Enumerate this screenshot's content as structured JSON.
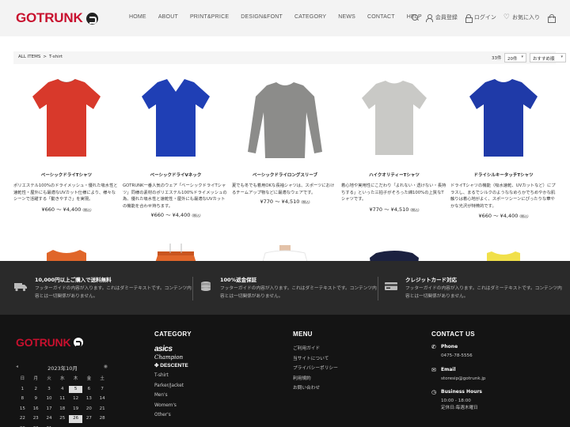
{
  "header": {
    "logo": "GOTRUNK",
    "nav": [
      "HOME",
      "ABOUT",
      "PRINT&PRICE",
      "DESIGN&FONT",
      "CATEGORY",
      "NEWS",
      "CONTACT",
      "HELP"
    ],
    "register": "会員登録",
    "login": "ログイン",
    "favorites": "お気に入り"
  },
  "breadcrumb": {
    "root": "ALL ITEMS",
    "sep": ">",
    "current": "T-shirt"
  },
  "toolbar": {
    "count": "33件",
    "per_page": "20件",
    "sort": "おすすめ順"
  },
  "products": [
    {
      "name": "ベーシックドライTシャツ",
      "desc": "ポリエステル100%のドライメッシュ・優れた吸水性と速乾性・屋外にも最適なUVカット仕様により、様々なシーンで活躍する「動きやすさ」を実現。",
      "price": "¥660 〜 ¥4,400",
      "tax": "(税込)",
      "color": "#d8392b"
    },
    {
      "name": "ベーシックドライVネック",
      "desc": "GOTRUNK一番人気のウェア「ベーシックドライTシャツ」同様の素材のポリエステル100%ドライメッシュの為、優れた吸水性と速乾性・屋外にも最適なUVカットの機能を合わせ持ちます。",
      "price": "¥660 〜 ¥4,400",
      "tax": "(税込)",
      "color": "#1f3fb5"
    },
    {
      "name": "ベーシックドライロングスリーブ",
      "desc": "夏でも冬でも着用OKな長袖シャツは、スポーツにおけるチームアップ物などに最適なウェアです。",
      "price": "¥770 〜 ¥4,510",
      "tax": "(税込)",
      "color": "#8c8c8a"
    },
    {
      "name": "ハイクオリティーTシャツ",
      "desc": "着心地や実用性にこだわり「よれない・透けない・長持ちする」といった三拍子がそろった綿100%の上質なTシャツです。",
      "price": "¥770 〜 ¥4,510",
      "tax": "(税込)",
      "color": "#c9c9c6"
    },
    {
      "name": "ドライシルキータッチTシャツ",
      "desc": "ドライTシャツの機能（吸水速乾、UVカットなど）にプラスし、まるでシルクのようななめらかでちめやかな肌触りは着心地がよく、スポーツシーンにぴったりな華やかな光沢が特徴的です。",
      "price": "¥660 〜 ¥4,400",
      "tax": "(税込)",
      "color": "#1f3aa8"
    }
  ],
  "row2_colors": [
    "#e0662a",
    "#e0662a",
    "#ffffff",
    "#1b2140",
    "#f1e04a"
  ],
  "features": [
    {
      "title": "10,000円以上ご購入で送料無料",
      "text": "フッターガイドの内容が入ります。これはダミーテキストです。コンテンツ内容とは一切関係がありません。",
      "icon": "truck-icon"
    },
    {
      "title": "100%返金保証",
      "text": "フッターガイドの内容が入ります。これはダミーテキストです。コンテンツ内容とは一切関係がありません。",
      "icon": "coins-icon"
    },
    {
      "title": "クレジットカード対応",
      "text": "フッターガイドの内容が入ります。これはダミーテキストです。コンテンツ内容とは一切関係がありません。",
      "icon": "credit-card-icon"
    }
  ],
  "footer": {
    "logo": "GOTRUNK",
    "calendar": {
      "title": "2023年10月",
      "weekdays": [
        "日",
        "月",
        "火",
        "水",
        "木",
        "金",
        "土"
      ],
      "days": [
        "1",
        "2",
        "3",
        "4",
        "5",
        "6",
        "7",
        "8",
        "9",
        "10",
        "11",
        "12",
        "13",
        "14",
        "15",
        "16",
        "17",
        "18",
        "19",
        "20",
        "21",
        "22",
        "23",
        "24",
        "25",
        "26",
        "27",
        "28",
        "29",
        "30",
        "31"
      ],
      "highlight": [
        "5",
        "26"
      ]
    },
    "category": {
      "title": "CATEGORY",
      "brands": [
        "asics",
        "Champion",
        "DESCENTE"
      ],
      "links": [
        "T-shirt",
        "Parker/Jacket",
        "Men's",
        "Womem's",
        "Other's"
      ]
    },
    "menu": {
      "title": "MENU",
      "links": [
        "ご利用ガイド",
        "当サイトについて",
        "プライバシーポリシー",
        "利用規約",
        "お問い合わせ"
      ]
    },
    "contact": {
      "title": "CONTACT US",
      "phone_label": "Phone",
      "phone": "0475-78-5556",
      "email_label": "Email",
      "email": "storesip@gotrunk.jp",
      "hours_label": "Business Hours",
      "hours": "10:00 - 18:00",
      "holiday": "定休日:毎週木曜日"
    }
  }
}
